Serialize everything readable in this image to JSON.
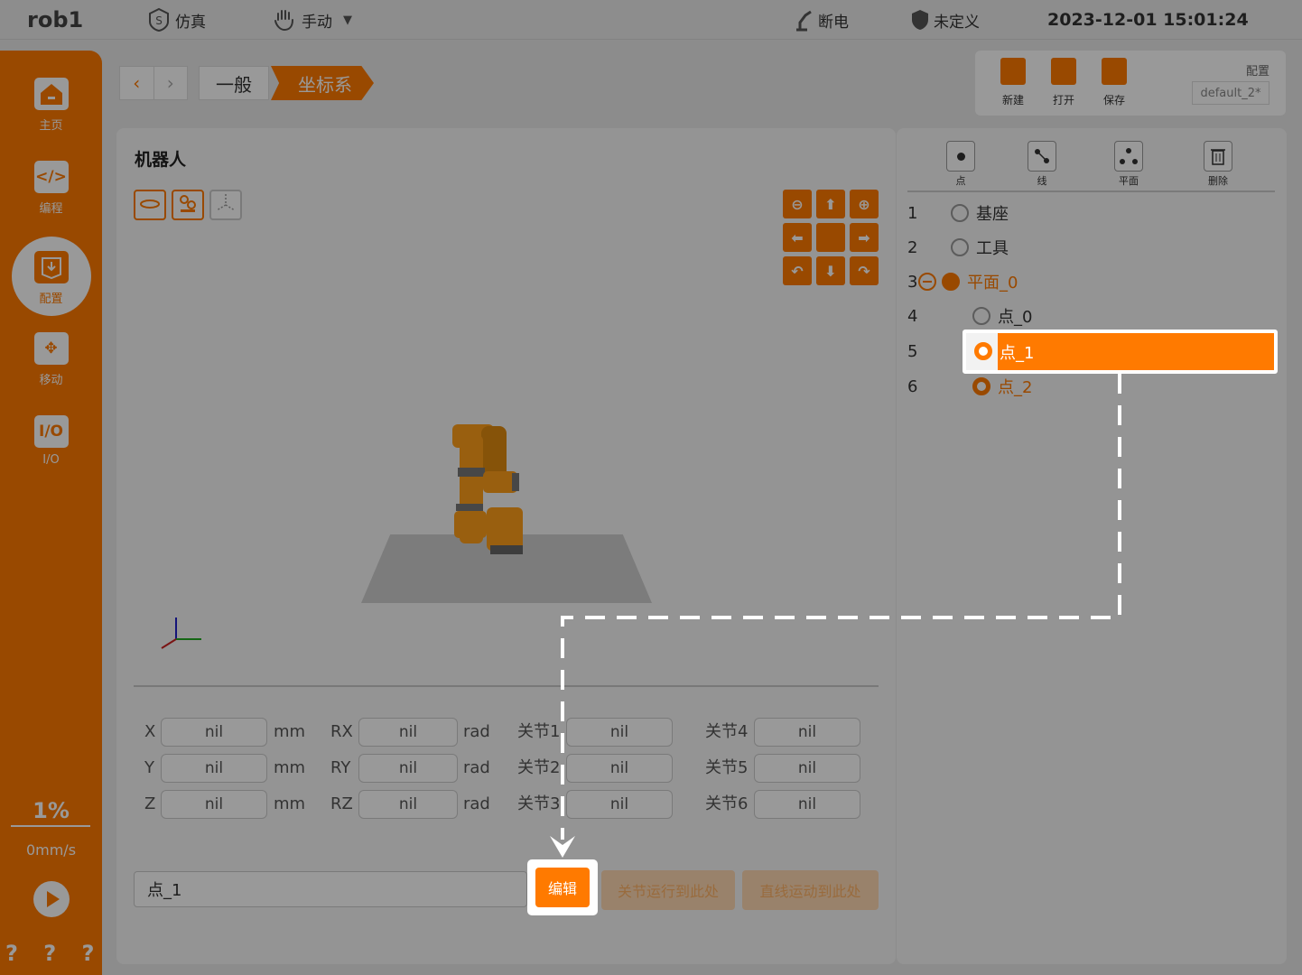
{
  "topbar": {
    "title": "rob1",
    "sim_label": "仿真",
    "mode_label": "手动",
    "power_label": "断电",
    "safety_label": "未定义",
    "datetime": "2023-12-01 15:01:24"
  },
  "sidebar": {
    "items": [
      {
        "label": "主页",
        "icon": "home-icon"
      },
      {
        "label": "编程",
        "icon": "code-icon"
      },
      {
        "label": "配置",
        "icon": "config-icon"
      },
      {
        "label": "移动",
        "icon": "move-icon"
      },
      {
        "label": "I/O",
        "icon": "io-icon",
        "glyph": "I/O"
      }
    ],
    "speed_percent": "1%",
    "speed_mm": "0mm/s",
    "help": "? ? ? ?"
  },
  "breadcrumb": {
    "items": [
      "一般",
      "坐标系"
    ]
  },
  "file": {
    "new": "新建",
    "open": "打开",
    "save": "保存",
    "config_label": "配置",
    "config_name": "default_2*"
  },
  "robot": {
    "title": "机器人"
  },
  "fields": {
    "x": "X",
    "y": "Y",
    "z": "Z",
    "rx": "RX",
    "ry": "RY",
    "rz": "RZ",
    "j1": "关节1",
    "j2": "关节2",
    "j3": "关节3",
    "j4": "关节4",
    "j5": "关节5",
    "j6": "关节6",
    "mm": "mm",
    "rad": "rad",
    "value": "nil"
  },
  "bottom": {
    "name_value": "点_1",
    "edit": "编辑",
    "joint_move": "关节运行到此处",
    "linear_move": "直线运动到此处"
  },
  "tools": {
    "point": "点",
    "line": "线",
    "plane": "平面",
    "delete": "删除"
  },
  "tree": [
    {
      "num": "1",
      "label": "基座"
    },
    {
      "num": "2",
      "label": "工具"
    },
    {
      "num": "3",
      "label": "平面_0"
    },
    {
      "num": "4",
      "label": "点_0"
    },
    {
      "num": "5",
      "label": "点_1"
    },
    {
      "num": "6",
      "label": "点_2"
    }
  ],
  "colors": {
    "accent": "#ff7a00",
    "overlay": "rgba(0,0,0,0.40)"
  }
}
